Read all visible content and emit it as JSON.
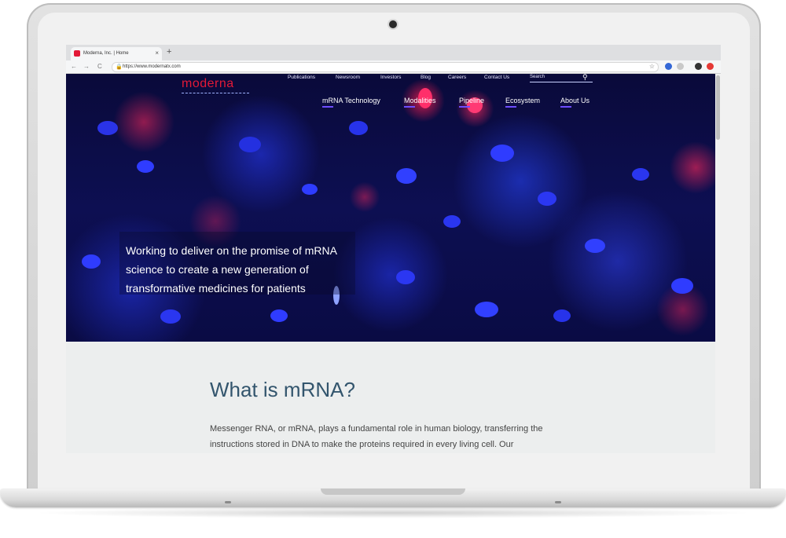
{
  "browser": {
    "tab_title": "Moderna, Inc. | Home",
    "tab_close": "×",
    "new_tab": "+",
    "url": "https://www.modernatx.com",
    "nav_back": "←",
    "nav_forward": "→",
    "nav_reload": "C"
  },
  "site": {
    "logo": "moderna",
    "utility_nav": [
      "Publications",
      "Newsroom",
      "Investors",
      "Blog",
      "Careers",
      "Contact Us"
    ],
    "search_placeholder": "Search",
    "main_nav": [
      "mRNA Technology",
      "Modalities",
      "Pipeline",
      "Ecosystem",
      "About Us"
    ],
    "hero_tagline": "Working to deliver on the promise of mRNA science to create a new generation of transformative medicines for patients",
    "section_heading": "What is mRNA?",
    "section_body": "Messenger RNA, or mRNA, plays a fundamental role in human biology, transferring the instructions stored in DNA to make the proteins required in every living cell. Our"
  },
  "colors": {
    "brand_red": "#e31937",
    "nav_underline": "#6e4dff",
    "heading": "#33556d"
  }
}
